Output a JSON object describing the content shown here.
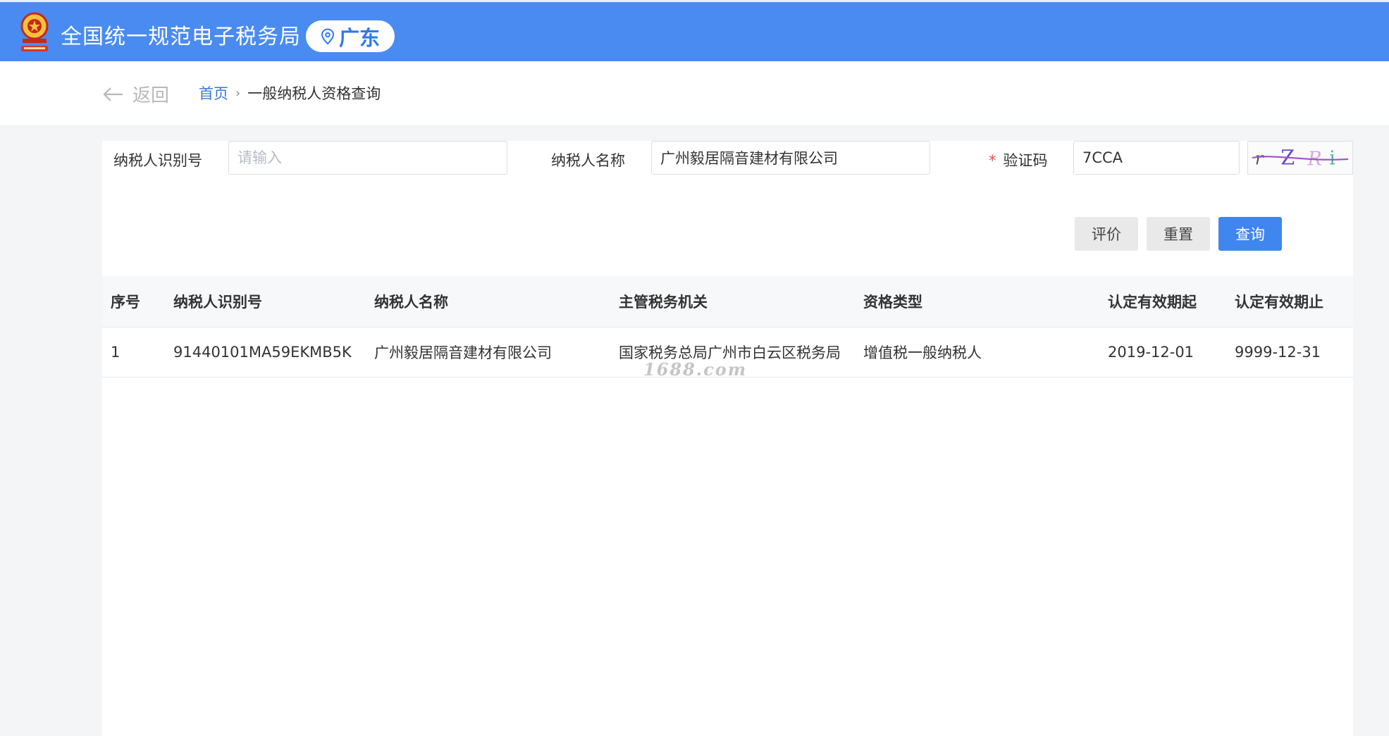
{
  "header": {
    "title": "全国统一规范电子税务局",
    "region": "广东",
    "emblem_icon": "tax-emblem-icon",
    "location_icon": "location-pin-icon",
    "bg_color": "#4a8bf1"
  },
  "breadcrumb": {
    "back_label": "返回",
    "home": "首页",
    "separator": "›",
    "current": "一般纳税人资格查询"
  },
  "form": {
    "taxpayer_id": {
      "label": "纳税人识别号",
      "value": "",
      "placeholder": "请输入"
    },
    "taxpayer_name": {
      "label": "纳税人名称",
      "value": "广州毅居隔音建材有限公司",
      "placeholder": ""
    },
    "captcha": {
      "required_mark": "*",
      "label": "验证码",
      "value": "7CCA",
      "image_text": "rZRi"
    },
    "buttons": {
      "evaluate": "评价",
      "reset": "重置",
      "query": "查询"
    }
  },
  "table": {
    "columns": [
      "序号",
      "纳税人识别号",
      "纳税人名称",
      "主管税务机关",
      "资格类型",
      "认定有效期起",
      "认定有效期止"
    ],
    "rows": [
      [
        "1",
        "91440101MA59EKMB5K",
        "广州毅居隔音建材有限公司",
        "国家税务总局广州市白云区税务局",
        "增值税一般纳税人",
        "2019-12-01",
        "9999-12-31"
      ]
    ]
  },
  "watermark": "1688.com"
}
